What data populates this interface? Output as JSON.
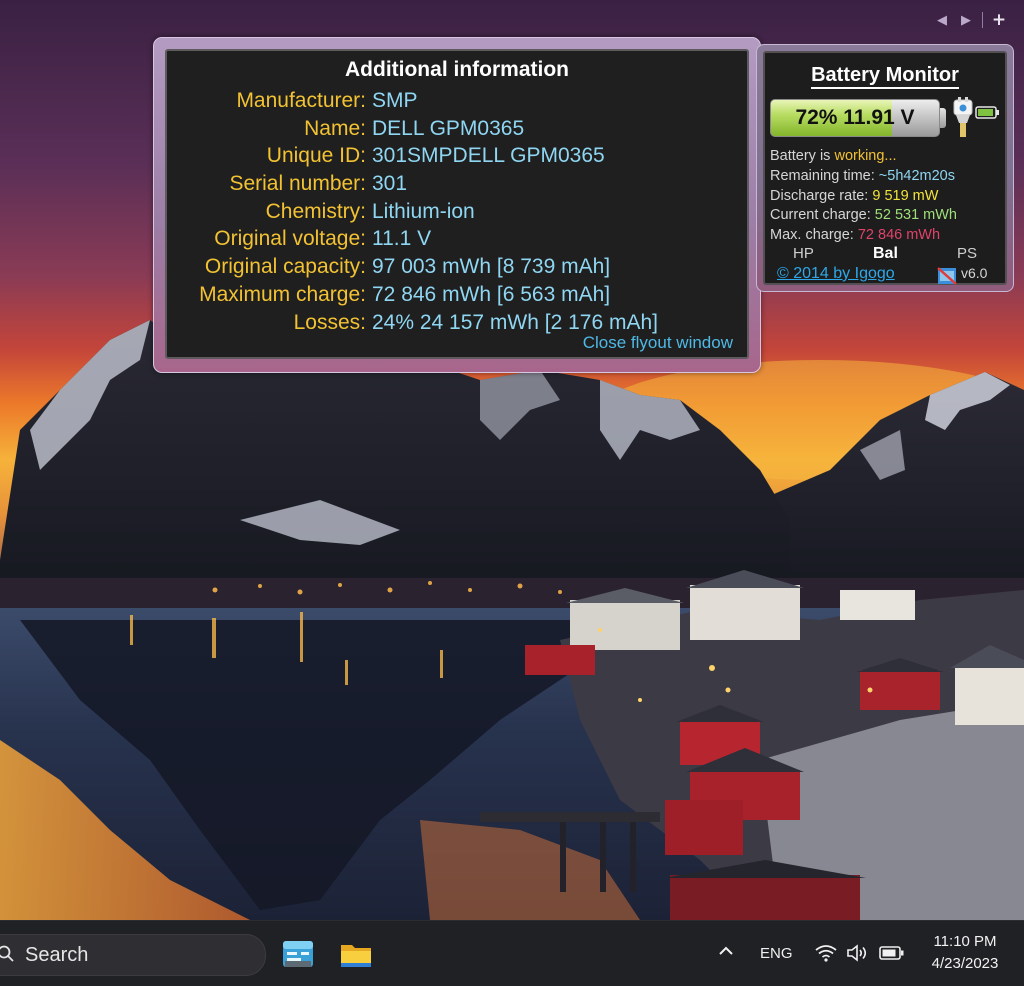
{
  "gadget_controls": {
    "prev_icon": "◀",
    "next_icon": "▶",
    "add_icon": "+"
  },
  "flyout": {
    "title": "Additional information",
    "rows": [
      {
        "label": "Manufacturer:",
        "value": "SMP"
      },
      {
        "label": "Name:",
        "value": "DELL GPM0365"
      },
      {
        "label": "Unique ID:",
        "value": "301SMPDELL GPM0365"
      },
      {
        "label": "Serial number:",
        "value": "301"
      },
      {
        "label": "Chemistry:",
        "value": "Lithium-ion"
      },
      {
        "label": "Original voltage:",
        "value": "11.1 V"
      },
      {
        "label": "Original capacity:",
        "value": "97 003 mWh [8 739 mAh]"
      },
      {
        "label": "Maximum charge:",
        "value": "72 846 mWh [6 563 mAh]"
      },
      {
        "label": "Losses:",
        "value": "24% 24 157 mWh [2 176 mAh]"
      }
    ],
    "close_link": "Close flyout window"
  },
  "gadget": {
    "title": "Battery Monitor",
    "charge_level": 0.72,
    "battery_readout": "72% 11.91 V",
    "status": {
      "battery_label": "Battery is ",
      "battery_state": "working...",
      "remaining_label": "Remaining time: ",
      "remaining_value": "~5h42m20s",
      "discharge_label": "Discharge rate: ",
      "discharge_value": "9 519 mW",
      "current_label": "Current charge: ",
      "current_value": "52 531 mWh",
      "max_label": "Max. charge: ",
      "max_value": "72 846 mWh"
    },
    "modes": {
      "hp": "HP",
      "bal": "Bal",
      "ps": "PS"
    },
    "credit": "© 2014 by Igogo",
    "version": "v6.0",
    "colors": {
      "working": "#f2c233",
      "remaining": "#8fd6f2",
      "discharge": "#f2e33a",
      "current": "#9fe07a",
      "max": "#e0436a"
    }
  },
  "taskbar": {
    "search_label": "Search",
    "language": "ENG",
    "time": "11:10 PM",
    "date": "4/23/2023",
    "icons": [
      "widgets-icon",
      "file-explorer-icon",
      "chevron-up-icon",
      "wifi-icon",
      "volume-icon",
      "battery-icon"
    ]
  }
}
